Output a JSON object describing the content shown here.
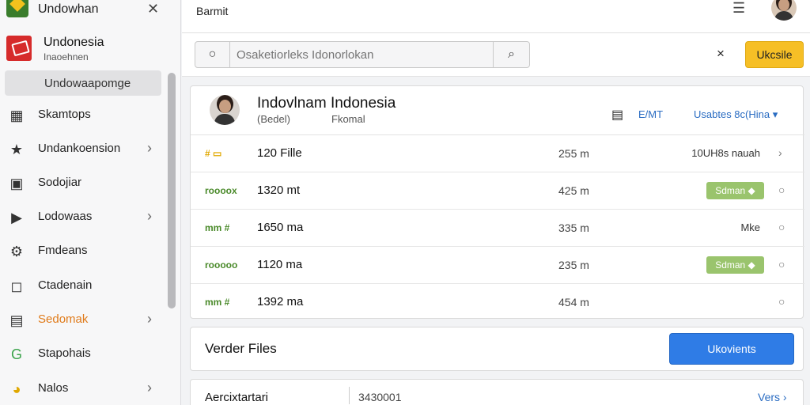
{
  "sidebar": {
    "app_title": "Undowhan",
    "header": {
      "name": "Undonesia",
      "sub": "Inaoehnen"
    },
    "selected": "Undowaapomge",
    "items": [
      {
        "label": "Skamtops",
        "icon": "grid-icon",
        "chevron": false,
        "accent": false
      },
      {
        "label": "Undankoension",
        "icon": "star-icon",
        "chevron": true,
        "accent": false
      },
      {
        "label": "Sodojiar",
        "icon": "briefcase-icon",
        "chevron": false,
        "accent": false
      },
      {
        "label": "Lodowaas",
        "icon": "play-icon",
        "chevron": true,
        "accent": false
      },
      {
        "label": "Fmdeans",
        "icon": "gear-icon",
        "chevron": false,
        "accent": false
      },
      {
        "label": "Ctadenain",
        "icon": "square-icon",
        "chevron": false,
        "accent": false
      },
      {
        "label": "Sedomak",
        "icon": "list-icon",
        "chevron": true,
        "accent": true
      },
      {
        "label": "Stapohais",
        "icon": "g-icon",
        "chevron": false,
        "accent": false
      },
      {
        "label": "Nalos",
        "icon": "pie-icon",
        "chevron": true,
        "accent": false
      }
    ]
  },
  "topbar": {
    "title": "Barmit"
  },
  "search": {
    "placeholder": "Osaketiorleks Idonorlokan",
    "clear_label": "×",
    "action_label": "Ukcsile"
  },
  "card": {
    "title": "Indovlnam Indonesia",
    "sub1": "(Bedel)",
    "sub2": "Fkomal",
    "link1": "E/MT",
    "link2": "Usabtes 8c(Hina ▾",
    "rows": [
      {
        "tag": "# ▭",
        "tag_color": "yellow",
        "name": "120 Fille",
        "size": "255 m",
        "status": "10UH8s nauah",
        "badge": "",
        "end": "›"
      },
      {
        "tag": "roooox",
        "tag_color": "green",
        "name": "1320 mt",
        "size": "425 m",
        "status": "",
        "badge": "Sdman ◆",
        "end": "○"
      },
      {
        "tag": "mm #",
        "tag_color": "green",
        "name": "1650 ma",
        "size": "335 m",
        "status": "Mke",
        "badge": "",
        "end": "○"
      },
      {
        "tag": "rooooo",
        "tag_color": "green",
        "name": "1120 ma",
        "size": "235 m",
        "status": "",
        "badge": "Sdman ◆",
        "end": "○"
      },
      {
        "tag": "mm #",
        "tag_color": "green",
        "name": "1392 ma",
        "size": "454 m",
        "status": "",
        "badge": "",
        "end": "○"
      }
    ]
  },
  "verder": {
    "title": "Verder Files",
    "button": "Ukovients"
  },
  "bottom": {
    "label": "Aercixtartari",
    "value": "3430001",
    "link": "Vers ›"
  },
  "colors": {
    "accent_yellow": "#f6bf26",
    "primary_blue": "#2f7ce6",
    "badge_green": "#9ac46d",
    "orange_text": "#e07b1a"
  }
}
